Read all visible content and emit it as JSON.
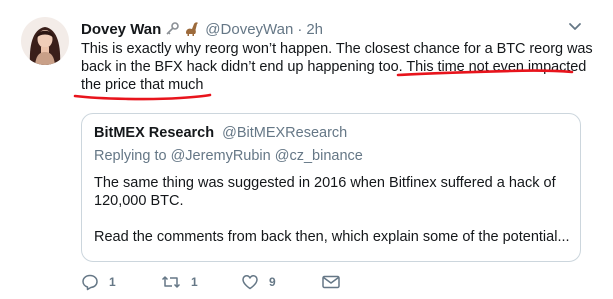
{
  "tweet": {
    "display_name": "Dovey Wan",
    "handle": "@DoveyWan",
    "separator": "·",
    "time": "2h",
    "emojis": [
      "key-emoji",
      "sauropod-emoji"
    ],
    "text_lines": [
      "This is exactly why reorg won’t happen. The closest chance for a BTC reorg was",
      "back in the BFX hack didn’t end up happening too. This time not even impacted",
      "the price that much"
    ],
    "annotation_color": "#e8141c"
  },
  "quoted_tweet": {
    "display_name": "BitMEX Research",
    "handle": "@BitMEXResearch",
    "replying_prefix": "Replying to",
    "replying_to": [
      "@JeremyRubin",
      "@cz_binance"
    ],
    "text_lines": [
      "The same thing was suggested in 2016 when Bitfinex suffered a hack of",
      "120,000 BTC."
    ],
    "text_line_after_gap": "Read the comments from back then, which explain some of the potential..."
  },
  "actions": {
    "reply_count": "1",
    "retweet_count": "1",
    "like_count": "9"
  },
  "colors": {
    "text": "#14171a",
    "secondary": "#657786",
    "border": "#ccd6dd"
  }
}
